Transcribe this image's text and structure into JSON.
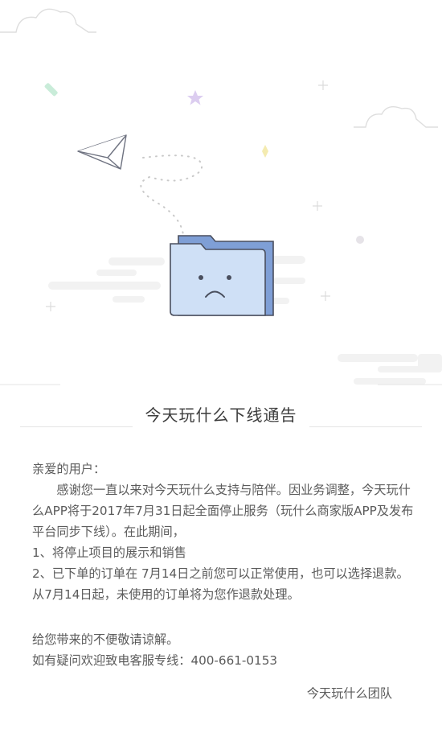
{
  "notice": {
    "title": "今天玩什么下线通告",
    "greeting": "亲爱的用户：",
    "paragraph1": "感谢您一直以来对今天玩什么支持与陪伴。因业务调整，今天玩什么APP将于2017年7月31日起全面停止服务（玩什么商家版APP及发布平台同步下线）。在此期间，",
    "item1": "1、将停止项目的展示和销售",
    "item2": "2、已下单的订单在 7月14日之前您可以正常使用，也可以选择退款。从7月14日起，未使用的订单将为您作退款处理。",
    "apology": "给您带来的不便敬请谅解。",
    "hotline": "如有疑问欢迎致电客服专线：400-661-0153",
    "signature": "今天玩什么团队"
  },
  "illustration": {
    "icons": [
      "sad-folder-icon",
      "paper-plane-icon",
      "star-icon",
      "cloud-icon",
      "sparkle-icon"
    ],
    "colors": {
      "folder_front": "#cfe0f6",
      "folder_back": "#7f9fd6",
      "folder_outline": "#4a4f5e",
      "star": "#d9c9ee",
      "sparkle_green": "#c9ecd9",
      "sparkle_yellow": "#f4ebb0",
      "cloud_stroke": "#dedede",
      "speed_lines": "#f1f1f1"
    }
  }
}
